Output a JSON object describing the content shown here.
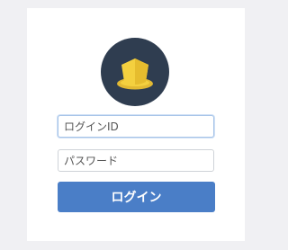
{
  "logo": {
    "icon": "yellow-hat-icon",
    "background_color": "#2f3d50",
    "hat_color": "#f4d03f"
  },
  "form": {
    "login_id": {
      "value": "",
      "placeholder": "ログインID"
    },
    "password": {
      "value": "",
      "placeholder": "パスワード"
    },
    "login_button_label": "ログイン"
  },
  "colors": {
    "accent": "#4a7ec7",
    "page_background": "#f0f0f3",
    "card_background": "#ffffff"
  }
}
